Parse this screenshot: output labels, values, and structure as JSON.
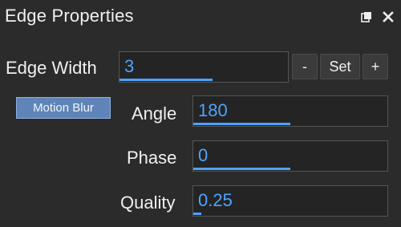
{
  "panel": {
    "title": "Edge Properties",
    "icons": {
      "dock": "dock-icon",
      "close": "close-icon"
    }
  },
  "edge_width": {
    "label": "Edge Width",
    "value": "3",
    "fill_fraction": 0.55,
    "decrement_label": "-",
    "set_label": "Set",
    "increment_label": "+"
  },
  "motion_blur": {
    "toggle_label": "Motion Blur",
    "angle": {
      "label": "Angle",
      "value": "180",
      "fill_fraction": 0.5
    },
    "phase": {
      "label": "Phase",
      "value": "0",
      "fill_fraction": 0.5
    },
    "quality": {
      "label": "Quality",
      "value": "0.25",
      "fill_fraction": 0.04
    }
  },
  "colors": {
    "accent": "#4da3ff",
    "toggle_active": "#5f84b8",
    "background": "#2b2b2b"
  }
}
